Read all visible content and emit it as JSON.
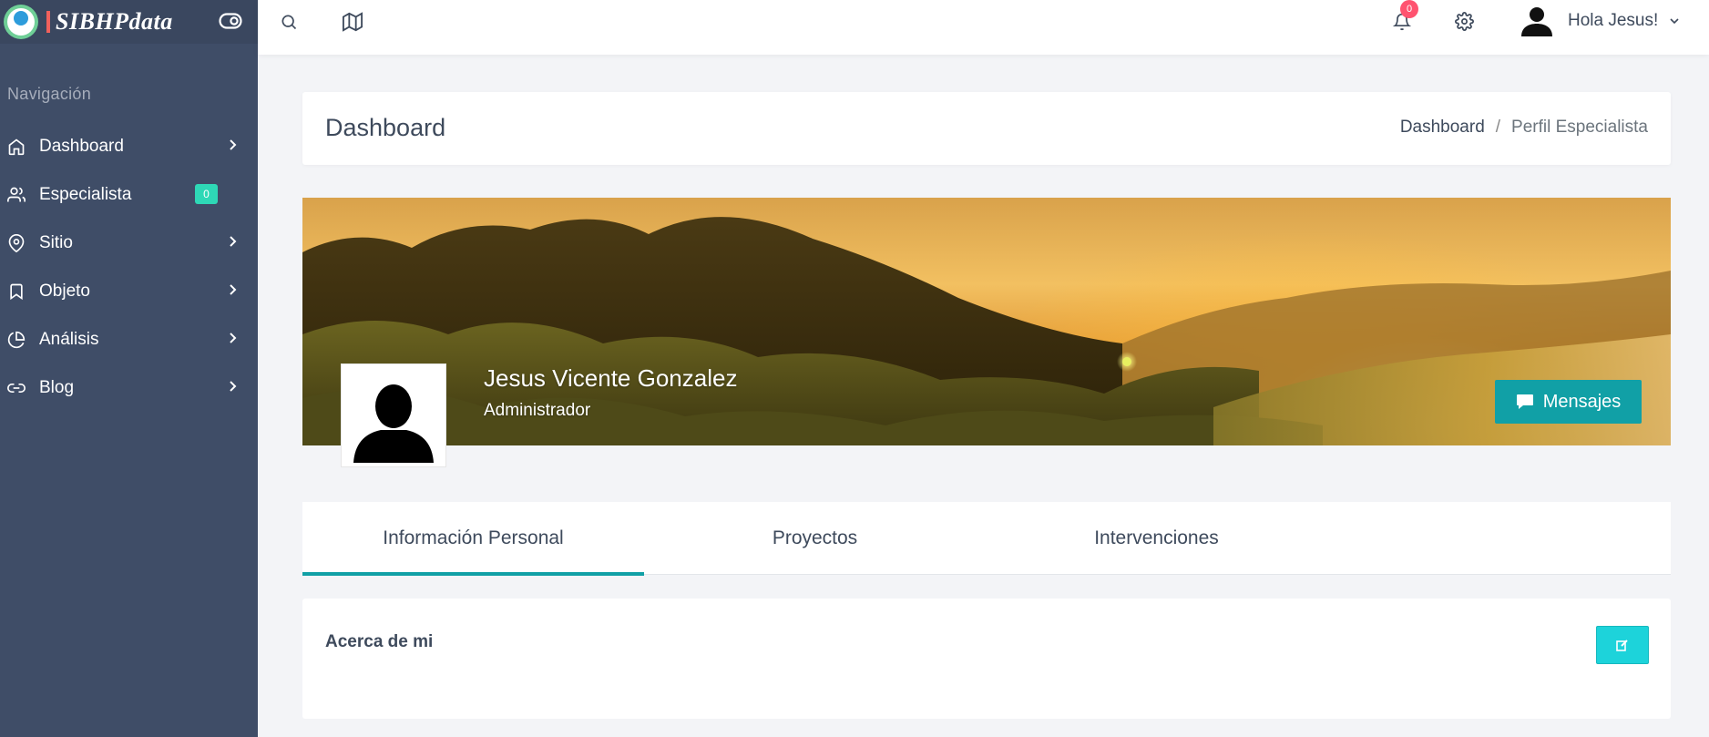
{
  "brand": {
    "name": "SIBHPdata"
  },
  "sidebar": {
    "caption": "Navigación",
    "items": [
      {
        "label": "Dashboard",
        "icon": "home-icon"
      },
      {
        "label": "Especialista",
        "icon": "users-icon",
        "badge": "0"
      },
      {
        "label": "Sitio",
        "icon": "map-pin-icon"
      },
      {
        "label": "Objeto",
        "icon": "bookmark-icon"
      },
      {
        "label": "Análisis",
        "icon": "pie-chart-icon"
      },
      {
        "label": "Blog",
        "icon": "link-icon"
      }
    ]
  },
  "topbar": {
    "notifications_count": "0",
    "greeting": "Hola Jesus!"
  },
  "page_header": {
    "title": "Dashboard",
    "breadcrumb": [
      "Dashboard",
      "Perfil Especialista"
    ]
  },
  "profile": {
    "name": "Jesus Vicente Gonzalez",
    "role": "Administrador",
    "messages_label": "Mensajes"
  },
  "tabs": [
    "Información Personal",
    "Proyectos",
    "Intervenciones"
  ],
  "about": {
    "title": "Acerca de mi"
  },
  "colors": {
    "sidebar_bg": "#3f4d67",
    "accent": "#11a0a6",
    "edit_button": "#1dd3da",
    "badge_green": "#2ed8b6",
    "badge_red": "#ff5370"
  }
}
